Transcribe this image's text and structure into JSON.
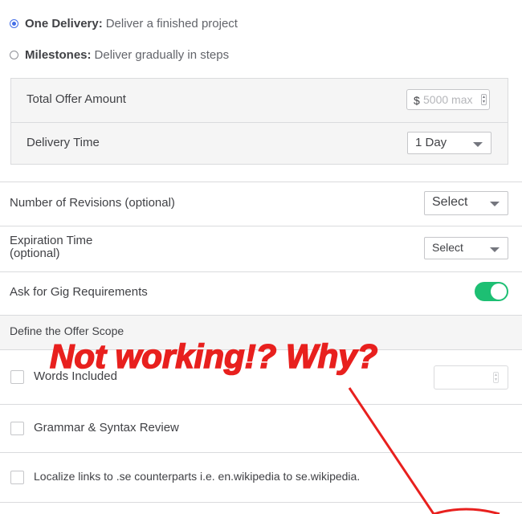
{
  "delivery_options": [
    {
      "bold": "One Delivery:",
      "text": "Deliver a finished project",
      "selected": true
    },
    {
      "bold": "Milestones:",
      "text": "Deliver gradually in steps",
      "selected": false
    }
  ],
  "offer": {
    "amount_label": "Total Offer Amount",
    "currency": "$",
    "amount_placeholder": "5000 max",
    "delivery_label": "Delivery Time",
    "delivery_value": "1 Day"
  },
  "revisions": {
    "label": "Number of Revisions (optional)",
    "value": "Select"
  },
  "expiration": {
    "label_line1": "Expiration Time",
    "label_line2": "(optional)",
    "value": "Select"
  },
  "requirements": {
    "label": "Ask for Gig Requirements",
    "toggle_on": true
  },
  "scope": {
    "header": "Define the Offer Scope",
    "items": [
      {
        "label": "Words Included",
        "checked": false
      },
      {
        "label": "Grammar & Syntax Review",
        "checked": false
      },
      {
        "label": "Localize links to .se counterparts i.e. en.wikipedia to se.wikipedia.",
        "checked": false
      }
    ]
  },
  "annotation": {
    "text": "Not working!? Why?",
    "color": "#e8201e"
  },
  "colors": {
    "accent": "#446ee7",
    "toggle_green": "#1dbf73"
  }
}
